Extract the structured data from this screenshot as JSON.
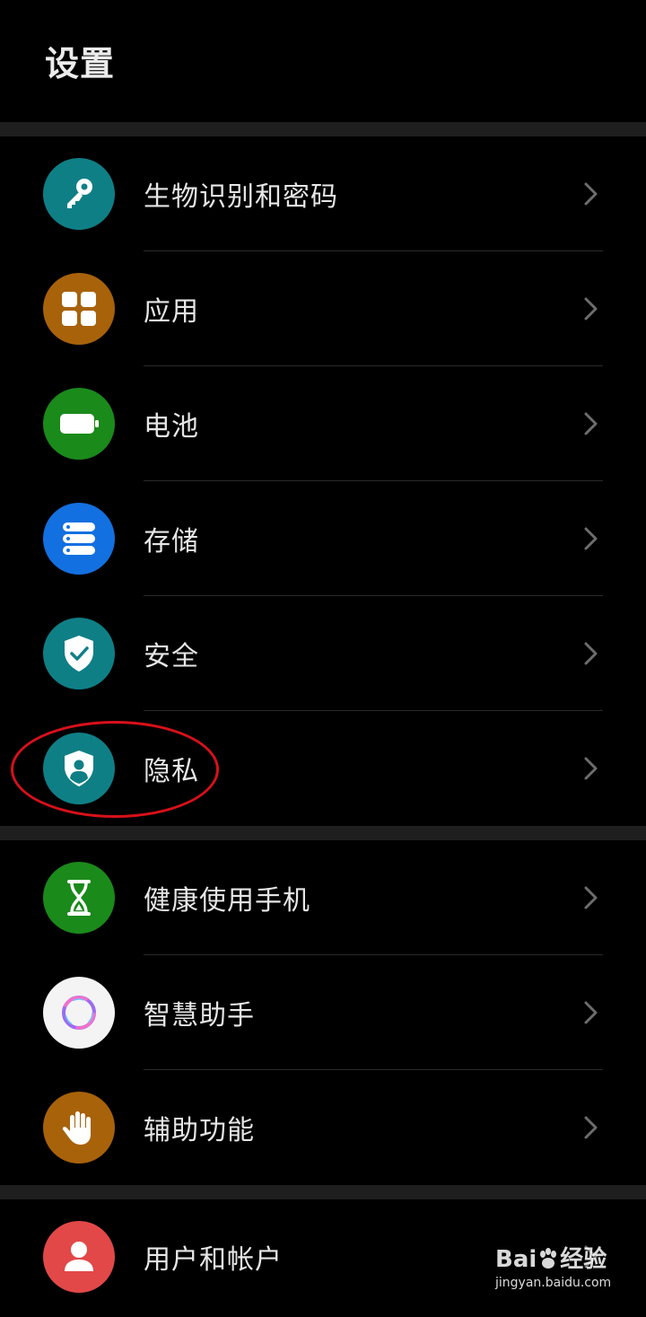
{
  "page": {
    "title": "设置"
  },
  "sections": [
    {
      "items": [
        {
          "label": "生物识别和密码",
          "icon": "key-icon",
          "color": "#0f7f86"
        },
        {
          "label": "应用",
          "icon": "apps-grid-icon",
          "color": "#a8620a"
        },
        {
          "label": "电池",
          "icon": "battery-icon",
          "color": "#1a8a1a"
        },
        {
          "label": "存储",
          "icon": "storage-icon",
          "color": "#1370e0"
        },
        {
          "label": "安全",
          "icon": "shield-check-icon",
          "color": "#0f7f86"
        },
        {
          "label": "隐私",
          "icon": "privacy-shield-icon",
          "color": "#0f7f86"
        }
      ]
    },
    {
      "items": [
        {
          "label": "健康使用手机",
          "icon": "hourglass-icon",
          "color": "#1a8a1a"
        },
        {
          "label": "智慧助手",
          "icon": "assistant-ring-icon",
          "color": "#f4f4f4"
        },
        {
          "label": "辅助功能",
          "icon": "hand-icon",
          "color": "#a8620a"
        }
      ]
    },
    {
      "items": [
        {
          "label": "用户和帐户",
          "icon": "user-icon",
          "color": "#e24848"
        }
      ]
    }
  ],
  "annotation": {
    "highlighted_item": "隐私",
    "color": "#d8101a"
  },
  "watermark": {
    "brand": "Bai",
    "brand2": "经验",
    "url": "jingyan.baidu.com"
  }
}
